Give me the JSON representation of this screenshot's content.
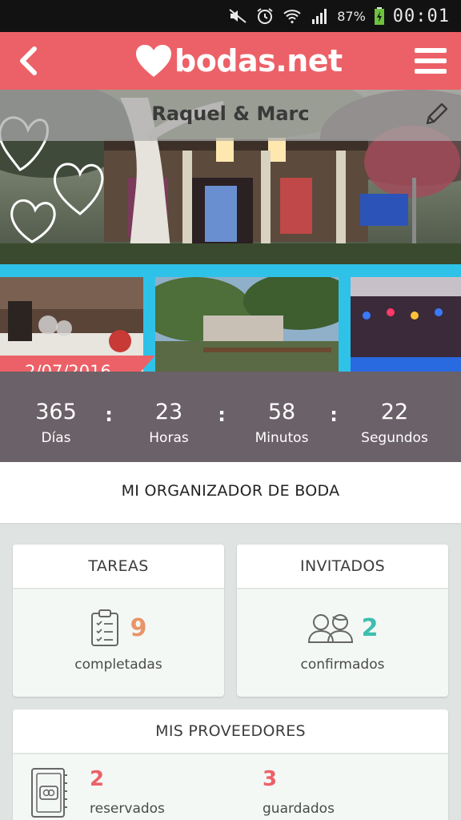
{
  "status_bar": {
    "battery_percent": "87%",
    "time": "00:01",
    "icons": [
      "mute-icon",
      "alarm-icon",
      "wifi-icon",
      "signal-icon",
      "battery-charging-icon"
    ]
  },
  "header": {
    "logo_text": "bodas.net",
    "back_icon": "chevron-left-icon",
    "menu_icon": "hamburger-menu-icon"
  },
  "hero": {
    "couple_name": "Raquel & Marc",
    "edit_icon": "pencil-icon"
  },
  "wedding_date": "2/07/2016",
  "countdown": [
    {
      "value": "365",
      "label": "Días"
    },
    {
      "value": "23",
      "label": "Horas"
    },
    {
      "value": "58",
      "label": "Minutos"
    },
    {
      "value": "22",
      "label": "Segundos"
    }
  ],
  "countdown_separator": ":",
  "organizer_title": "MI ORGANIZADOR DE BODA",
  "tareas": {
    "title": "TAREAS",
    "count": "9",
    "label": "completadas",
    "icon": "clipboard-checklist-icon"
  },
  "invitados": {
    "title": "INVITADOS",
    "count": "2",
    "label": "confirmados",
    "icon": "guests-couple-icon"
  },
  "proveedores": {
    "title": "MIS PROVEEDORES",
    "reserved_count": "2",
    "reserved_label": "reservados",
    "saved_count": "3",
    "saved_label": "guardados",
    "icon": "vendor-book-icon"
  },
  "colors": {
    "brand": "#ec6167",
    "accent_orange": "#e8956a",
    "accent_teal": "#3dbfaf",
    "countdown_bg": "#6b6168",
    "strip_blue": "#2fc2e8"
  }
}
